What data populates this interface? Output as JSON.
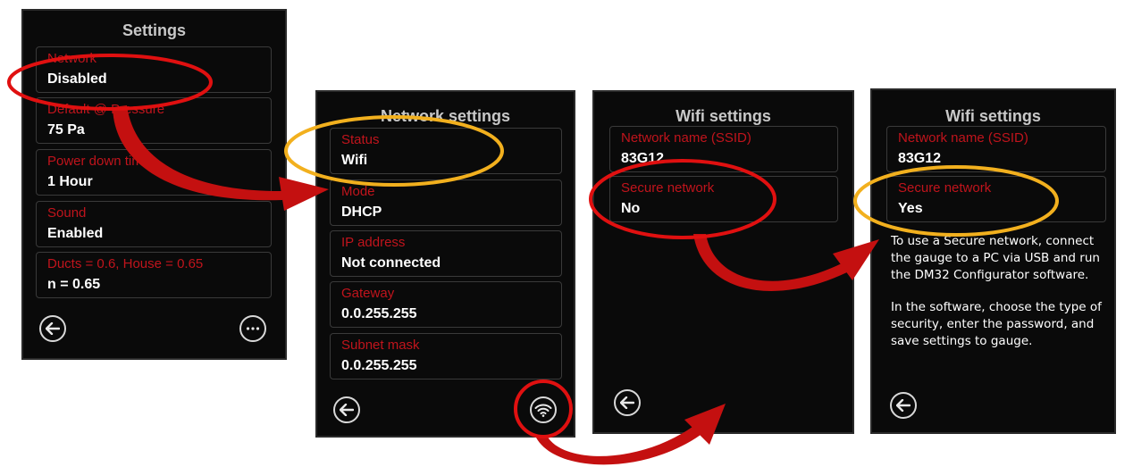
{
  "screen1": {
    "title": "Settings",
    "fields": [
      {
        "label": "Network",
        "value": "Disabled"
      },
      {
        "label": "Default @ Pressure",
        "value": "75 Pa"
      },
      {
        "label": "Power down time",
        "value": "1 Hour"
      },
      {
        "label": "Sound",
        "value": "Enabled"
      },
      {
        "label": "Ducts = 0.6, House = 0.65",
        "value": "n = 0.65"
      }
    ],
    "back_icon": "back-arrow-icon",
    "more_icon": "ellipsis-icon"
  },
  "screen2": {
    "title": "Network settings",
    "fields": [
      {
        "label": "Status",
        "value": "Wifi"
      },
      {
        "label": "Mode",
        "value": "DHCP"
      },
      {
        "label": "IP address",
        "value": "Not connected"
      },
      {
        "label": "Gateway",
        "value": "0.0.255.255"
      },
      {
        "label": "Subnet mask",
        "value": "0.0.255.255"
      }
    ],
    "back_icon": "back-arrow-icon",
    "wifi_icon": "wifi-icon"
  },
  "screen3": {
    "title": "Wifi settings",
    "fields": [
      {
        "label": "Network name (SSID)",
        "value": "83G12"
      },
      {
        "label": "Secure network",
        "value": "No"
      }
    ],
    "back_icon": "back-arrow-icon"
  },
  "screen4": {
    "title": "Wifi settings",
    "fields": [
      {
        "label": "Network name (SSID)",
        "value": "83G12"
      },
      {
        "label": "Secure network",
        "value": "Yes"
      }
    ],
    "info_paragraphs": [
      "To use a Secure network, connect the gauge to a PC via USB and run the DM32 Configurator software.",
      "In the software, choose the type of security, enter the password, and save settings to gauge."
    ],
    "back_icon": "back-arrow-icon"
  },
  "colors": {
    "label_red": "#c0141c",
    "highlight_red": "#e01010",
    "highlight_yellow": "#f2b01e",
    "screen_bg": "#0a0a0a"
  }
}
